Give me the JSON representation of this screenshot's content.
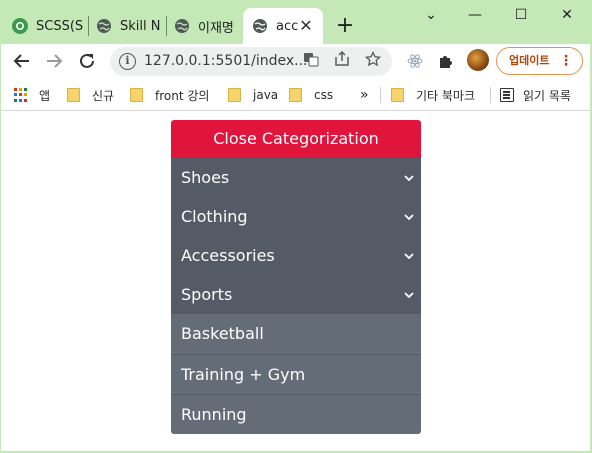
{
  "browser": {
    "tabs": [
      {
        "title": "SCSS(S",
        "icon": "scss-favicon",
        "active": false
      },
      {
        "title": "Skill No",
        "icon": "globe-icon",
        "active": false
      },
      {
        "title": "이재명",
        "icon": "globe-icon",
        "active": false
      },
      {
        "title": "acc",
        "icon": "globe-icon",
        "active": true
      }
    ],
    "close_tab_glyph": "✕",
    "new_tab_glyph": "+",
    "window_controls": {
      "minimize": "⌄",
      "restore": "—",
      "maximize": "☐",
      "close": "✕"
    },
    "url": "127.0.0.1:5501/index....",
    "update_button_label": "업데이트",
    "accent_color": "#c5e8b7"
  },
  "bookmarks": {
    "apps_label": "앱",
    "items": [
      "신규",
      "front 강의",
      "java",
      "css"
    ],
    "overflow": "»",
    "other_folder": "기타 북마크",
    "reading_list": "읽기 목록"
  },
  "accordion": {
    "header": "Close Categorization",
    "categories": [
      {
        "label": "Shoes"
      },
      {
        "label": "Clothing"
      },
      {
        "label": "Accessories"
      },
      {
        "label": "Sports"
      }
    ],
    "sub_items": [
      "Basketball",
      "Training + Gym",
      "Running"
    ],
    "colors": {
      "header": "#e1143c",
      "item": "#545a66",
      "sub_item": "#646c78"
    }
  }
}
